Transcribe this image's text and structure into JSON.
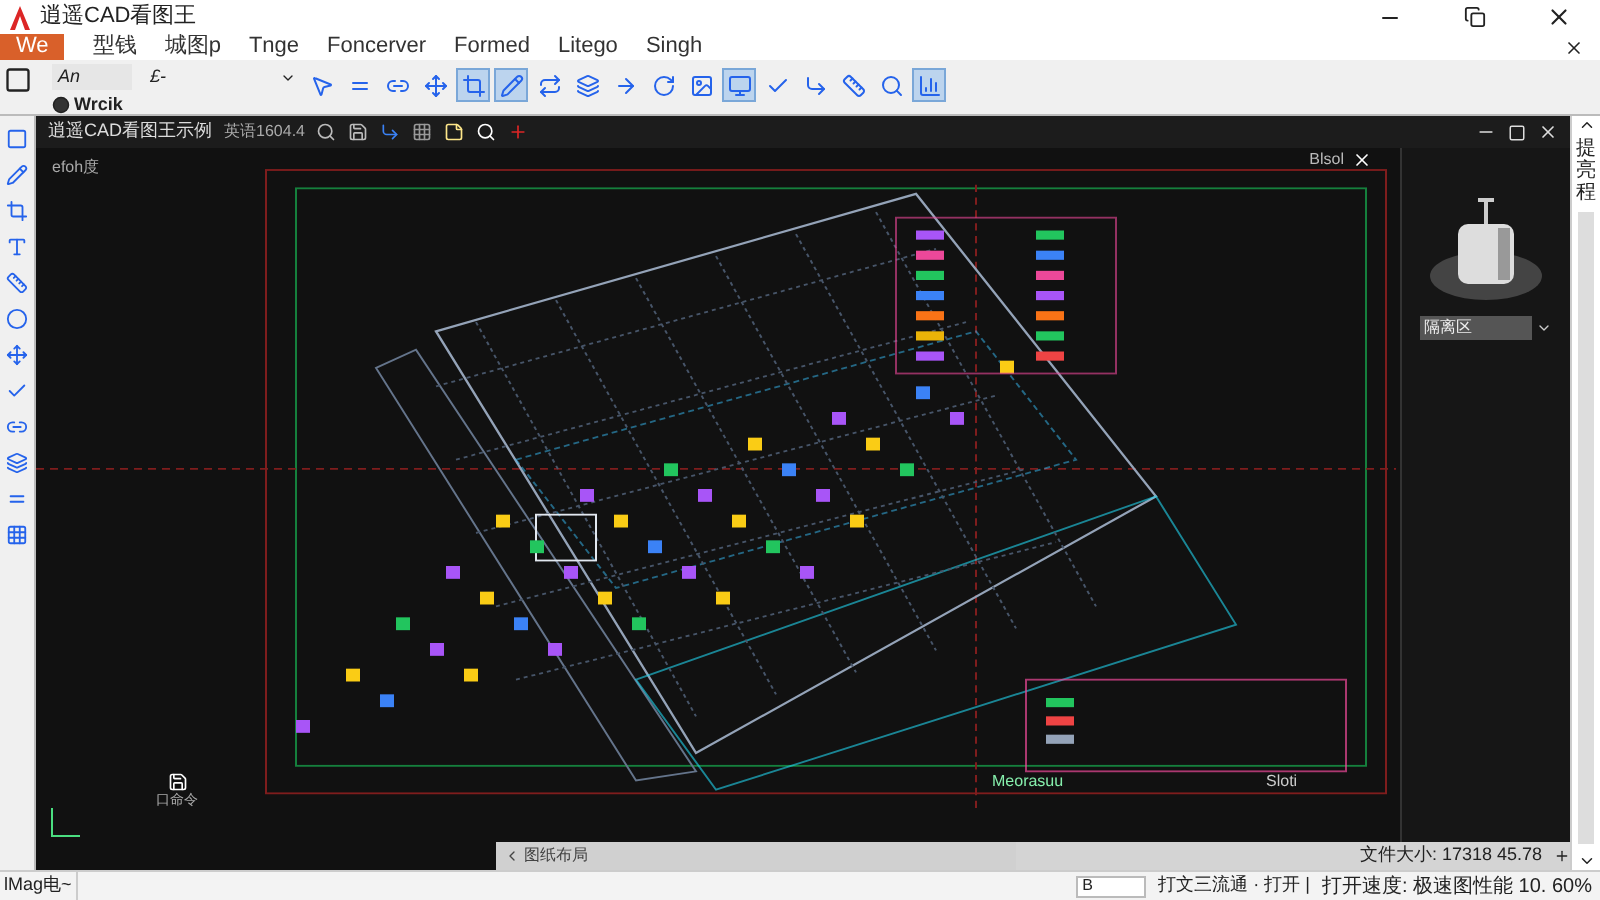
{
  "window": {
    "title": "逍遥CAD看图王"
  },
  "menu": [
    {
      "label": "We",
      "selected": true
    },
    {
      "label": "型钱",
      "selected": false
    },
    {
      "label": "城图p",
      "selected": false
    },
    {
      "label": "Tnge",
      "selected": false
    },
    {
      "label": "Foncerver",
      "selected": false
    },
    {
      "label": "Formed",
      "selected": false
    },
    {
      "label": "Litego",
      "selected": false
    },
    {
      "label": "Singh",
      "selected": false
    }
  ],
  "toolbar": {
    "layer_dropdown": "An",
    "style_dropdown": "£-",
    "second_row": "Wrcik",
    "tools": [
      {
        "selected": false
      },
      {
        "selected": false
      },
      {
        "selected": false
      },
      {
        "selected": false
      },
      {
        "selected": true
      },
      {
        "selected": true
      },
      {
        "selected": false
      },
      {
        "selected": false
      },
      {
        "selected": false
      },
      {
        "selected": false
      },
      {
        "selected": false
      },
      {
        "selected": true
      },
      {
        "selected": false
      },
      {
        "selected": false
      },
      {
        "selected": false
      },
      {
        "selected": false
      },
      {
        "selected": true
      }
    ]
  },
  "drawing_tab": {
    "title": "逍遥CAD看图王示例",
    "subtitle": "英语1604.4"
  },
  "canvas": {
    "corner_label": "efoh度",
    "model_label": "口命令",
    "title_block_label": "Meorasuu",
    "stamp_label": "Sloti",
    "frame_label": "Blsol"
  },
  "layout_bar": {
    "tab": "图纸布局",
    "file_size": "文件大小: 17318 45.78"
  },
  "right_panel": {
    "isolate_field": "隔离区",
    "side_text": "提亮程"
  },
  "status_bar": {
    "mode": "lMag电~",
    "input": "B",
    "message": "打文三流通 · 打开 |",
    "speed": "打开速度: 极速图性能 10. 60%"
  }
}
